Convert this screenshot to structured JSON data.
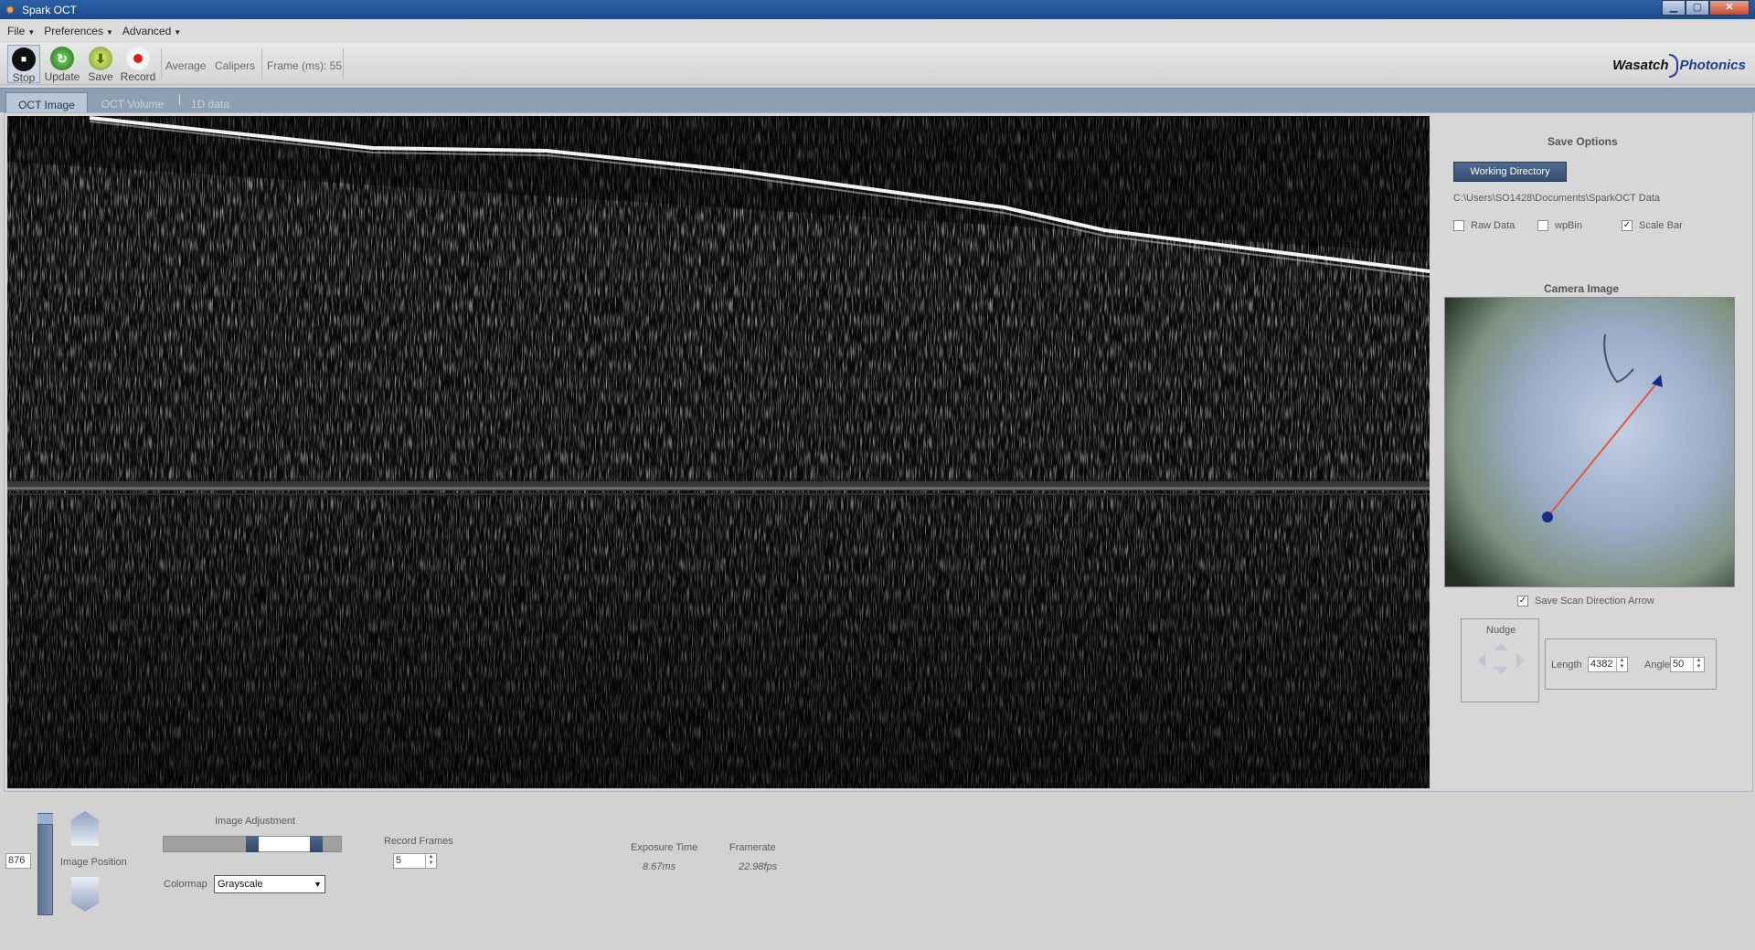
{
  "window": {
    "title": "Spark OCT",
    "min_label": "▁",
    "max_label": "▢",
    "close_label": "✕"
  },
  "menu": [
    {
      "label": "File"
    },
    {
      "label": "Preferences"
    },
    {
      "label": "Advanced"
    }
  ],
  "toolbar": {
    "stop_label": "Stop",
    "update_label": "Update",
    "save_label": "Save",
    "record_label": "Record",
    "average_label": "Average",
    "calipers_label": "Calipers",
    "frame_label": "Frame (ms): 55"
  },
  "logo": {
    "part1": "Wasatch",
    "part2": "Photonics"
  },
  "tabs": [
    {
      "label": "OCT Image",
      "active": true
    },
    {
      "label": "OCT Volume",
      "active": false
    },
    {
      "label": "1D data",
      "active": false
    }
  ],
  "save_options": {
    "title": "Save Options",
    "working_dir_button": "Working Directory",
    "path": "C:\\Users\\SO1428\\Documents\\SparkOCT Data",
    "raw_data": {
      "label": "Raw Data",
      "checked": false
    },
    "wpbin": {
      "label": "wpBin",
      "checked": false
    },
    "scale_bar": {
      "label": "Scale Bar",
      "checked": true
    }
  },
  "camera": {
    "title": "Camera Image",
    "save_arrow": {
      "label": "Save Scan Direction Arrow",
      "checked": true
    }
  },
  "nudge": {
    "title": "Nudge"
  },
  "scan": {
    "length_label": "Length",
    "length_value": "4382",
    "angle_label": "Angle",
    "angle_value": "50"
  },
  "bottom": {
    "position_value": "876",
    "image_position_label": "Image Position",
    "image_adjustment_label": "Image Adjustment",
    "colormap_label": "Colormap",
    "colormap_value": "Grayscale",
    "record_frames_label": "Record Frames",
    "record_frames_value": "5",
    "exposure_label": "Exposure Time",
    "exposure_value": "8.67ms",
    "framerate_label": "Framerate",
    "framerate_value": "22.98fps"
  },
  "colors": {
    "accent": "#344d70",
    "arrow_line": "#e05a3a",
    "arrow_head": "#1a2a8a"
  }
}
